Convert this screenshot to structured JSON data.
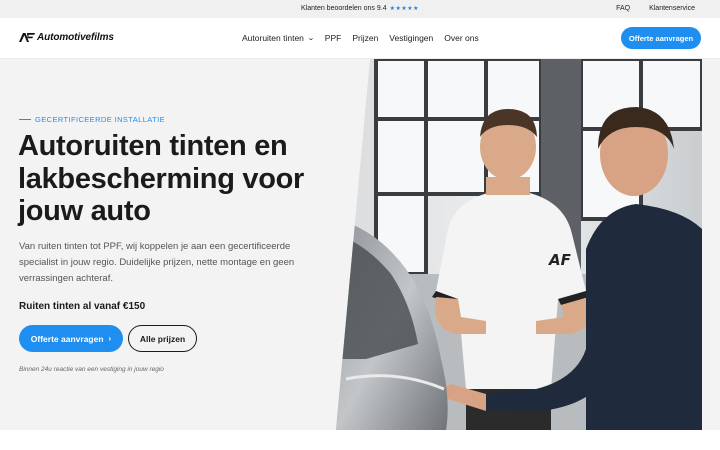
{
  "topbar": {
    "rating_text": "Klanten beoordelen ons 9.4",
    "stars": "★★★★★",
    "links": [
      "FAQ",
      "Klantenservice"
    ]
  },
  "nav": {
    "logo_text": "Automotivefilms",
    "menu": [
      "Autoruiten tinten",
      "PPF",
      "Prijzen",
      "Vestigingen",
      "Over ons"
    ],
    "cta": "Offerte aanvragen"
  },
  "hero": {
    "eyebrow": "GECERTIFICEERDE INSTALLATIE",
    "headline_lines": [
      "Autoruiten tinten en",
      "lakbescherming voor",
      "jouw auto"
    ],
    "description": "Van ruiten tinten tot PPF, wij koppelen je aan een gecertificeerde specialist in jouw regio. Duidelijke prijzen, nette montage en geen verrassingen achteraf.",
    "price": "Ruiten tinten al vanaf €150",
    "primary_button": "Offerte aanvragen",
    "secondary_button": "Alle prijzen",
    "note": "Binnen 24u reactie van een vestiging in jouw regio",
    "shirt_logo": "AF"
  },
  "colors": {
    "accent": "#1f8ef1",
    "hero_bg": "#f3f3f3",
    "topbar_bg": "#f0f0f0"
  },
  "icons": {
    "logo": "af-logo-icon",
    "menu_chevron": "chevron-down-icon",
    "button_arrow": "chevron-right-icon"
  }
}
